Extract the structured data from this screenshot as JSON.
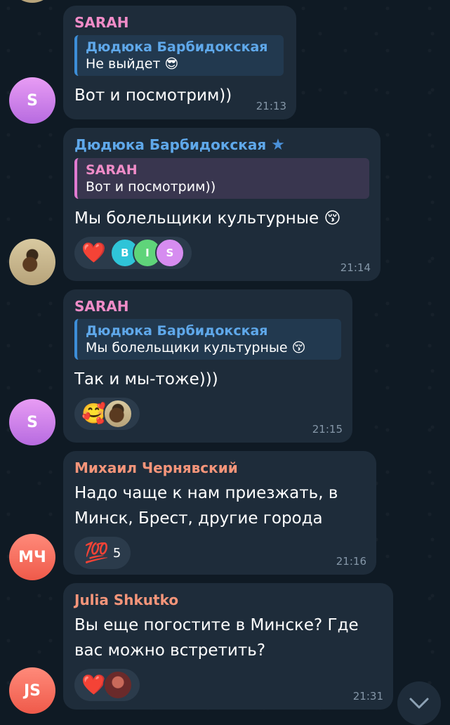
{
  "messages": [
    {
      "sender": "SARAH",
      "avatar": "S",
      "reply_name": "Дюдюка Барбидокская",
      "reply_text": "Не выйдет 😎",
      "text": "Вот и посмотрим))",
      "time": "21:13"
    },
    {
      "sender": "Дюдюка Барбидокская",
      "star": "★",
      "reply_name": "SARAH",
      "reply_text": "Вот и посмотрим))",
      "text": "Мы болельщики культурные 😚",
      "reaction_emoji": "❤️",
      "reactor_b": "B",
      "reactor_i": "I",
      "reactor_s": "S",
      "time": "21:14"
    },
    {
      "sender": "SARAH",
      "avatar": "S",
      "reply_name": "Дюдюка Барбидокская",
      "reply_text": "Мы болельщики культурные 😚",
      "text": "Так и мы-тоже)))",
      "reaction_emoji": "🥰",
      "time": "21:15"
    },
    {
      "sender": "Михаил Чернявский",
      "avatar": "МЧ",
      "text_line1": "Надо чаще к нам приезжать, в",
      "text_line2": "Минск, Брест, другие города",
      "reaction_emoji": "💯",
      "reaction_count": "5",
      "time": "21:16"
    },
    {
      "sender": "Julia Shkutko",
      "avatar": "JS",
      "text_line1": "Вы еще погостите в Минске? Где",
      "text_line2": "вас можно встретить?",
      "reaction_emoji": "❤️",
      "time": "21:31"
    }
  ],
  "colors": {
    "background": "#0f1a24",
    "bubble": "#1e2c3a",
    "sarah_name": "#f08cc8",
    "dudyuka_name": "#5fa8ea",
    "mikhail_name": "#f5957a"
  },
  "icons": {
    "scroll_down": "chevron-down-icon"
  }
}
